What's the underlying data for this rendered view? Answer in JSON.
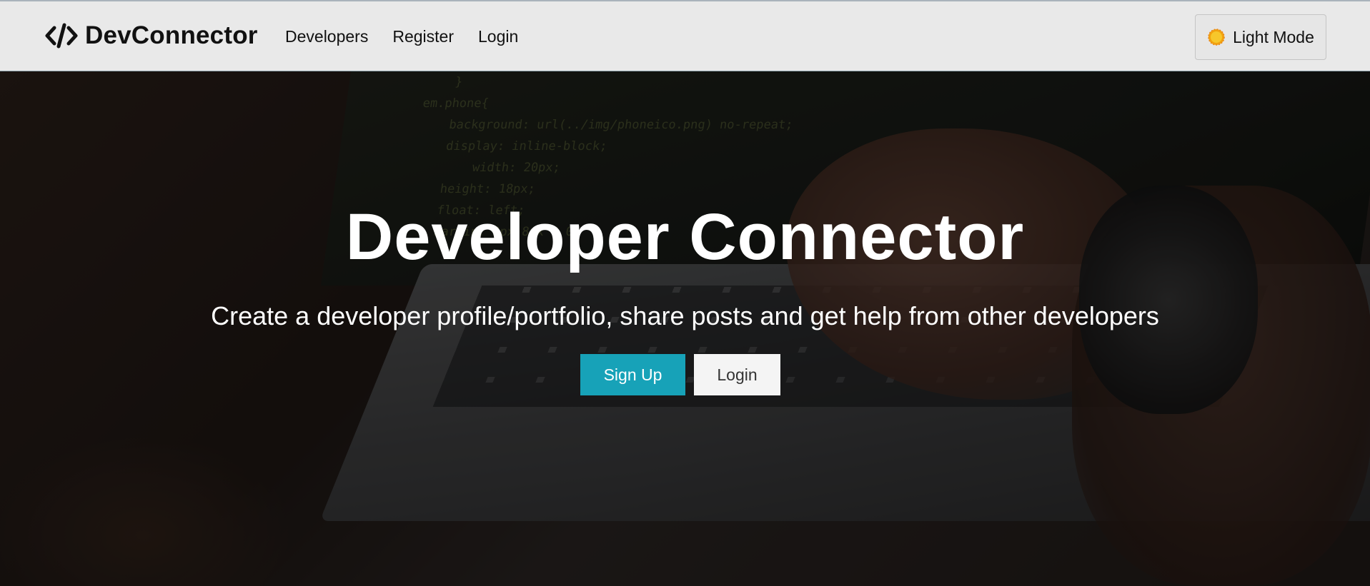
{
  "navbar": {
    "brand_icon": "code-icon",
    "brand_text": "DevConnector",
    "links": [
      {
        "label": "Developers"
      },
      {
        "label": "Register"
      },
      {
        "label": "Login"
      }
    ],
    "theme_toggle": {
      "icon": "sun-icon",
      "label": "Light Mode"
    }
  },
  "hero": {
    "title": "Developer Connector",
    "subtitle": "Create a developer profile/portfolio, share posts and get help from other developers",
    "buttons": {
      "signup_label": "Sign Up",
      "login_label": "Login"
    }
  },
  "colors": {
    "primary": "#17a2b8",
    "navbar_bg": "#e9e9e9",
    "light_button": "#f4f4f4",
    "sun": "#f2a20f"
  }
}
